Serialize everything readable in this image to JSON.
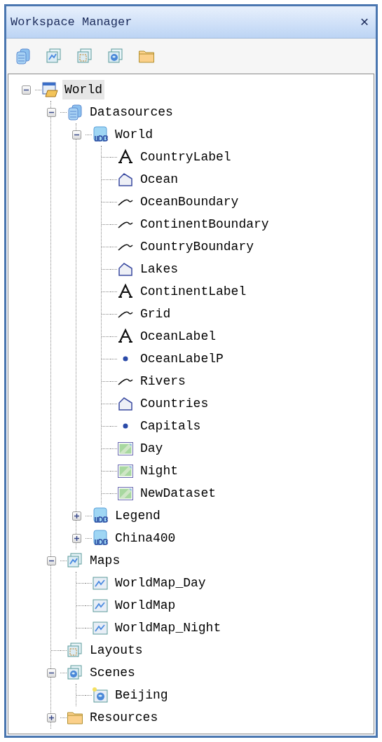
{
  "window": {
    "title": "Workspace Manager",
    "close": "✕"
  },
  "toolbar": [
    {
      "kind": "datasources"
    },
    {
      "kind": "maps"
    },
    {
      "kind": "layouts"
    },
    {
      "kind": "scenes"
    },
    {
      "kind": "resources"
    }
  ],
  "tree": [
    {
      "label": "World",
      "kind": "workspace",
      "selected": true,
      "expanded": true,
      "children": [
        {
          "label": "Datasources",
          "kind": "datasources",
          "selected": false,
          "expanded": true,
          "children": [
            {
              "label": "World",
              "kind": "udb",
              "selected": false,
              "expanded": true,
              "children": [
                {
                  "label": "CountryLabel",
                  "kind": "text",
                  "selected": false
                },
                {
                  "label": "Ocean",
                  "kind": "region",
                  "selected": false
                },
                {
                  "label": "OceanBoundary",
                  "kind": "line",
                  "selected": false
                },
                {
                  "label": "ContinentBoundary",
                  "kind": "line",
                  "selected": false
                },
                {
                  "label": "CountryBoundary",
                  "kind": "line",
                  "selected": false
                },
                {
                  "label": "Lakes",
                  "kind": "region",
                  "selected": false
                },
                {
                  "label": "ContinentLabel",
                  "kind": "text",
                  "selected": false
                },
                {
                  "label": "Grid",
                  "kind": "line",
                  "selected": false
                },
                {
                  "label": "OceanLabel",
                  "kind": "text",
                  "selected": false
                },
                {
                  "label": "OceanLabelP",
                  "kind": "point",
                  "selected": false
                },
                {
                  "label": "Rivers",
                  "kind": "line",
                  "selected": false
                },
                {
                  "label": "Countries",
                  "kind": "region",
                  "selected": false
                },
                {
                  "label": "Capitals",
                  "kind": "point",
                  "selected": false
                },
                {
                  "label": "Day",
                  "kind": "image",
                  "selected": false
                },
                {
                  "label": "Night",
                  "kind": "image",
                  "selected": false
                },
                {
                  "label": "NewDataset",
                  "kind": "image",
                  "selected": false
                }
              ]
            },
            {
              "label": "Legend",
              "kind": "udb",
              "selected": false,
              "expanded": false
            },
            {
              "label": "China400",
              "kind": "udb",
              "selected": false,
              "expanded": false
            }
          ]
        },
        {
          "label": "Maps",
          "kind": "maps",
          "selected": false,
          "expanded": true,
          "children": [
            {
              "label": "WorldMap_Day",
              "kind": "map",
              "selected": false
            },
            {
              "label": "WorldMap",
              "kind": "map",
              "selected": false
            },
            {
              "label": "WorldMap_Night",
              "kind": "map",
              "selected": false
            }
          ]
        },
        {
          "label": "Layouts",
          "kind": "layouts",
          "selected": false
        },
        {
          "label": "Scenes",
          "kind": "scenes",
          "selected": false,
          "expanded": true,
          "children": [
            {
              "label": "Beijing",
              "kind": "scene",
              "selected": false
            }
          ]
        },
        {
          "label": "Resources",
          "kind": "resources",
          "selected": false,
          "expanded": false
        }
      ]
    }
  ]
}
